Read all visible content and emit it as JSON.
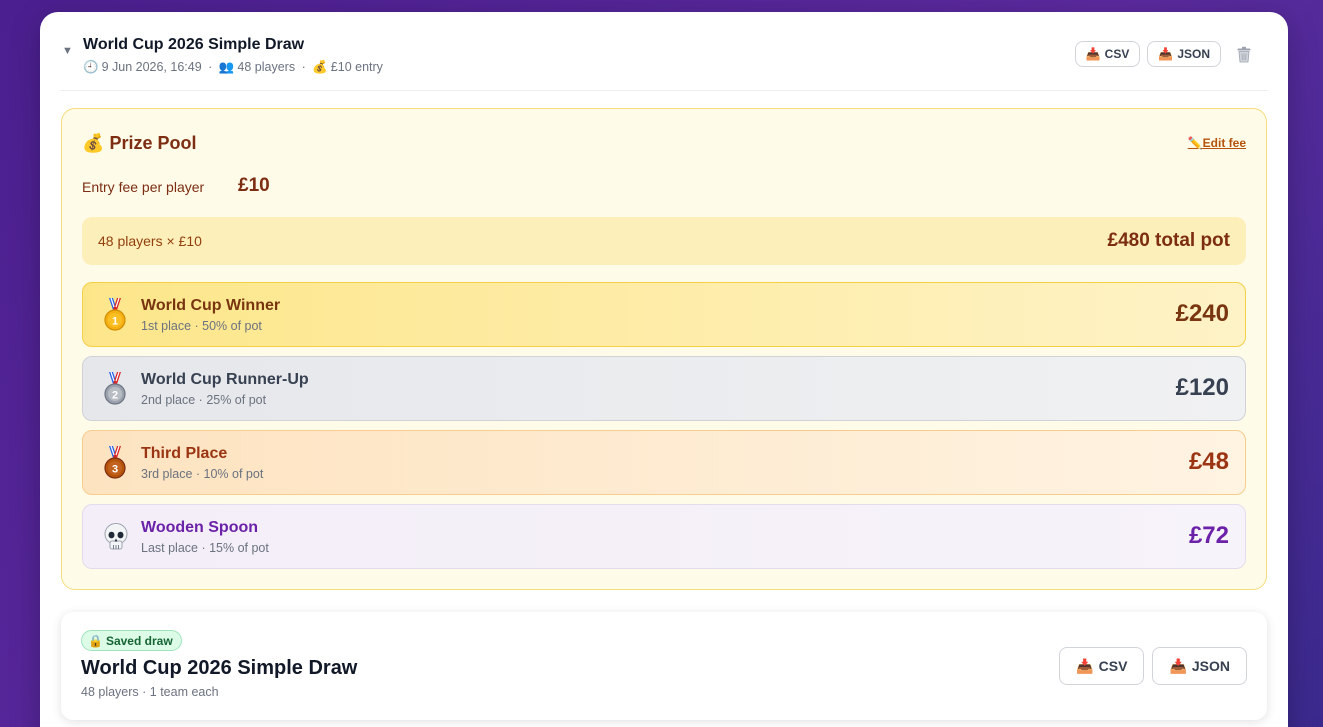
{
  "header": {
    "title": "World Cup 2026 Simple Draw",
    "date": "9 Jun 2026, 16:49",
    "players": "48 players",
    "entry": "£10 entry",
    "sep": "·",
    "csv_label": "CSV",
    "json_label": "JSON"
  },
  "prize_pool": {
    "title": "Prize Pool",
    "edit_label": "Edit fee",
    "fee_label": "Entry fee per player",
    "fee_value": "£10",
    "pot_calc": "48 players × £10",
    "pot_total": "£480 total pot",
    "prizes": [
      {
        "name": "World Cup Winner",
        "sub": "1st place · 50% of pot",
        "amount": "£240",
        "medal": "gold-medal-icon"
      },
      {
        "name": "World Cup Runner-Up",
        "sub": "2nd place · 25% of pot",
        "amount": "£120",
        "medal": "silver-medal-icon"
      },
      {
        "name": "Third Place",
        "sub": "3rd place · 10% of pot",
        "amount": "£48",
        "medal": "bronze-medal-icon"
      },
      {
        "name": "Wooden Spoon",
        "sub": "Last place · 15% of pot",
        "amount": "£72",
        "medal": "skull-icon"
      }
    ]
  },
  "saved_draw": {
    "badge": "Saved draw",
    "title": "World Cup 2026 Simple Draw",
    "meta": "48 players · 1 team each",
    "csv_label": "CSV",
    "json_label": "JSON"
  },
  "colors": {
    "background": "#4b1f8f",
    "pool_bg": "#fefbe8",
    "gold": "#fde68a",
    "silver": "#e5e7eb",
    "bronze": "#fde3c0",
    "spoon": "#f3eef7",
    "accent_text": "#7c2d12",
    "purple_text": "#6b21a8"
  }
}
